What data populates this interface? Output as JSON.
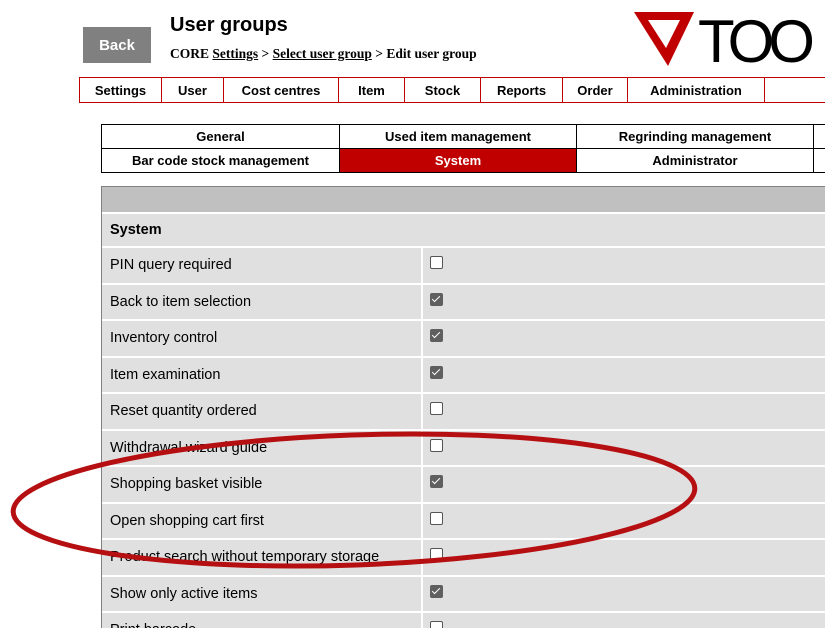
{
  "header": {
    "back_label": "Back",
    "title": "User groups",
    "breadcrumb": {
      "prefix": "CORE ",
      "settings_link": "Settings",
      "sep1": " > ",
      "select_link": "Select user group",
      "sep2": " > ",
      "current": "Edit user group"
    },
    "logo_text": "TOO"
  },
  "main_nav": [
    {
      "label": "Settings"
    },
    {
      "label": "User"
    },
    {
      "label": "Cost centres"
    },
    {
      "label": "Item"
    },
    {
      "label": "Stock"
    },
    {
      "label": "Reports"
    },
    {
      "label": "Order"
    },
    {
      "label": "Administration"
    }
  ],
  "sub_tabs": {
    "row1": [
      "General",
      "Used item management",
      "Regrinding management"
    ],
    "row2": [
      "Bar code stock management",
      "System",
      "Administrator"
    ],
    "active": "System"
  },
  "section": {
    "title": "System",
    "rows": [
      {
        "label": "PIN query required",
        "checked": false
      },
      {
        "label": "Back to item selection",
        "checked": true
      },
      {
        "label": "Inventory control",
        "checked": true
      },
      {
        "label": "Item examination",
        "checked": true
      },
      {
        "label": "Reset quantity ordered",
        "checked": false
      },
      {
        "label": "Withdrawal wizard guide",
        "checked": false
      },
      {
        "label": "Shopping basket visible",
        "checked": true
      },
      {
        "label": "Open shopping cart first",
        "checked": false
      },
      {
        "label": "Product search without temporary storage",
        "checked": false
      },
      {
        "label": "Show only active items",
        "checked": true
      },
      {
        "label": "Print barcode",
        "checked": false
      }
    ]
  },
  "colors": {
    "brand_red": "#c00000",
    "annotation_red": "#b50f12",
    "back_button": "#808080",
    "row_bg": "#e0e0e0"
  }
}
